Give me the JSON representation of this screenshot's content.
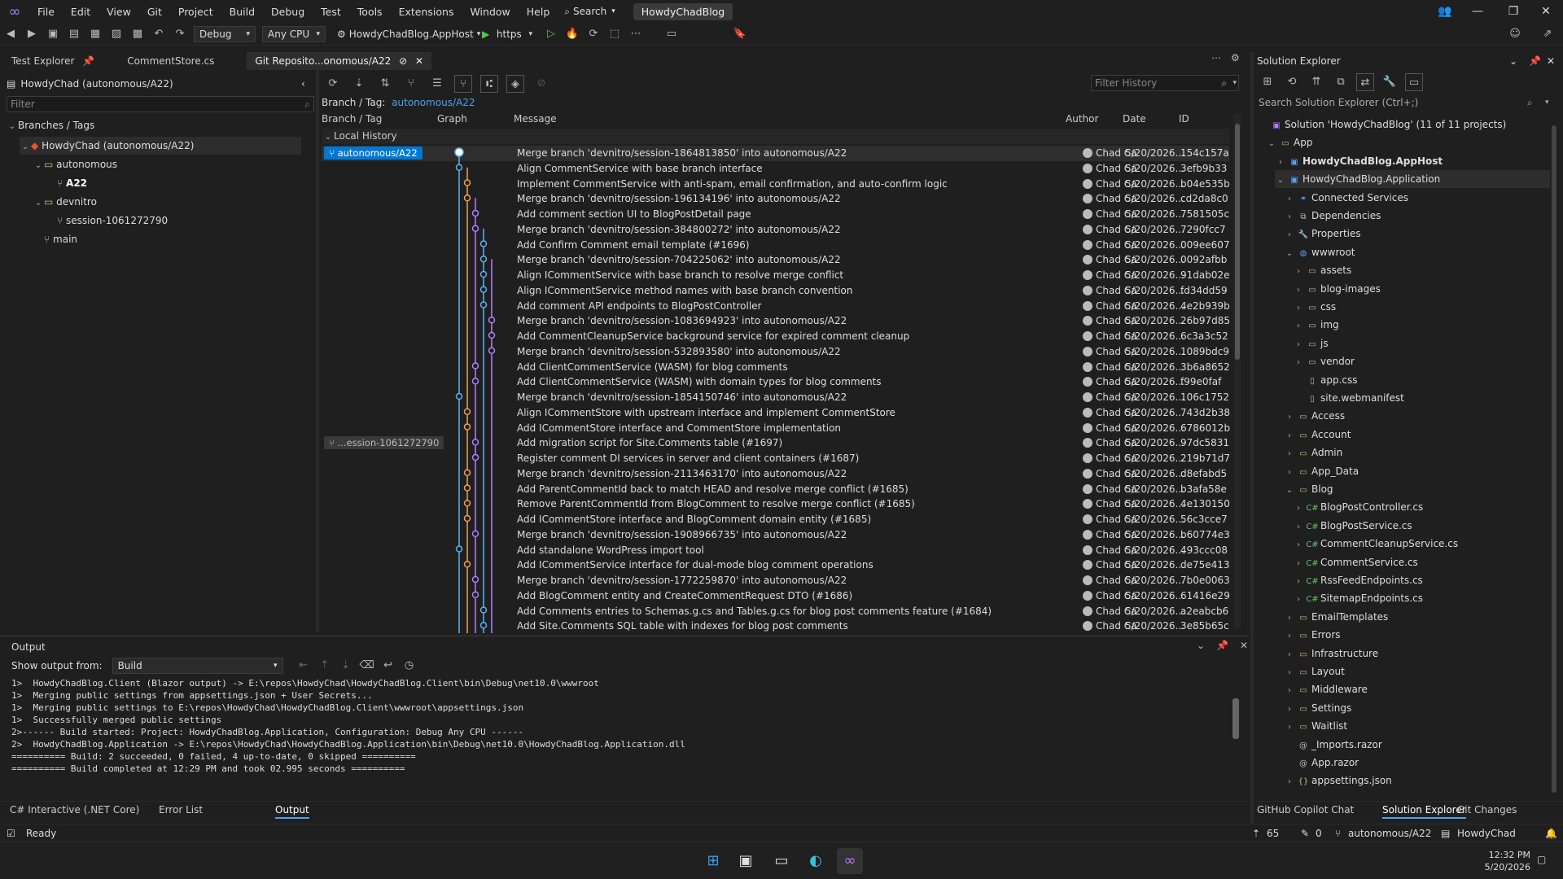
{
  "menubar": {
    "items": [
      "File",
      "Edit",
      "View",
      "Git",
      "Project",
      "Build",
      "Debug",
      "Test",
      "Tools",
      "Extensions",
      "Window",
      "Help"
    ],
    "search_label": "Search",
    "solution_title": "HowdyChadBlog"
  },
  "toolbar": {
    "config": "Debug",
    "platform": "Any CPU",
    "startup_project": "HowdyChadBlog.AppHost",
    "run_profile": "https"
  },
  "tabs": [
    {
      "label": "Test Explorer"
    },
    {
      "label": "CommentStore.cs"
    },
    {
      "label": "Git Reposito...onomous/A22"
    }
  ],
  "left_panel": {
    "header": "HowdyChad (autonomous/A22)",
    "filter_placeholder": "Filter",
    "section": "Branches / Tags",
    "tree": [
      {
        "label": "HowdyChad (autonomous/A22)",
        "kind": "repo"
      },
      {
        "label": "autonomous",
        "kind": "folder"
      },
      {
        "label": "A22",
        "kind": "branch"
      },
      {
        "label": "devnitro",
        "kind": "folder"
      },
      {
        "label": "session-1061272790",
        "kind": "branch"
      },
      {
        "label": "main",
        "kind": "branch"
      }
    ]
  },
  "history": {
    "filter_placeholder": "Filter History",
    "branch_label": "Branch / Tag:",
    "branch_value": "autonomous/A22",
    "columns": [
      "Branch / Tag",
      "Graph",
      "Message",
      "Author",
      "Date",
      "ID"
    ],
    "group": "Local History",
    "tag_current": "autonomous/A22",
    "tag_session": "...ession-1061272790",
    "commits": [
      {
        "message": "Merge branch 'devnitro/session-1864813850' into autonomous/A22",
        "author": "Chad Ca",
        "date": "5/20/2026...",
        "id": "154c157a"
      },
      {
        "message": "Align CommentService with base branch interface",
        "author": "Chad Ca",
        "date": "5/20/2026...",
        "id": "3efb9b33"
      },
      {
        "message": "Implement CommentService with anti-spam, email confirmation, and auto-confirm logic",
        "author": "Chad Ca",
        "date": "5/20/2026...",
        "id": "b04e535b"
      },
      {
        "message": "Merge branch 'devnitro/session-196134196' into autonomous/A22",
        "author": "Chad Ca",
        "date": "5/20/2026...",
        "id": "cd2da8c0"
      },
      {
        "message": "Add comment section UI to BlogPostDetail page",
        "author": "Chad Ca",
        "date": "5/20/2026...",
        "id": "7581505c"
      },
      {
        "message": "Merge branch 'devnitro/session-384800272' into autonomous/A22",
        "author": "Chad Ca",
        "date": "5/20/2026...",
        "id": "7290fcc7"
      },
      {
        "message": "Add Confirm Comment email template (#1696)",
        "author": "Chad Ca",
        "date": "5/20/2026...",
        "id": "009ee607"
      },
      {
        "message": "Merge branch 'devnitro/session-704225062' into autonomous/A22",
        "author": "Chad Ca",
        "date": "5/20/2026...",
        "id": "0092afbb"
      },
      {
        "message": "Align ICommentService with base branch to resolve merge conflict",
        "author": "Chad Ca",
        "date": "5/20/2026...",
        "id": "91dab02e"
      },
      {
        "message": "Align ICommentService method names with base branch convention",
        "author": "Chad Ca",
        "date": "5/20/2026...",
        "id": "fd34dd59"
      },
      {
        "message": "Add comment API endpoints to BlogPostController",
        "author": "Chad Ca",
        "date": "5/20/2026...",
        "id": "4e2b939b"
      },
      {
        "message": "Merge branch 'devnitro/session-1083694923' into autonomous/A22",
        "author": "Chad Ca",
        "date": "5/20/2026...",
        "id": "26b97d85"
      },
      {
        "message": "Add CommentCleanupService background service for expired comment cleanup",
        "author": "Chad Ca",
        "date": "5/20/2026...",
        "id": "6c3a3c52"
      },
      {
        "message": "Merge branch 'devnitro/session-532893580' into autonomous/A22",
        "author": "Chad Ca",
        "date": "5/20/2026...",
        "id": "1089bdc9"
      },
      {
        "message": "Add ClientCommentService (WASM) for blog comments",
        "author": "Chad Ca",
        "date": "5/20/2026...",
        "id": "3b6a8652"
      },
      {
        "message": "Add ClientCommentService (WASM) with domain types for blog comments",
        "author": "Chad Ca",
        "date": "5/20/2026...",
        "id": "f99e0faf"
      },
      {
        "message": "Merge branch 'devnitro/session-1854150746' into autonomous/A22",
        "author": "Chad Ca",
        "date": "5/20/2026...",
        "id": "106c1752"
      },
      {
        "message": "Align ICommentStore with upstream interface and implement CommentStore",
        "author": "Chad Ca",
        "date": "5/20/2026...",
        "id": "743d2b38"
      },
      {
        "message": "Add ICommentStore interface and CommentStore implementation",
        "author": "Chad Ca",
        "date": "5/20/2026...",
        "id": "6786012b"
      },
      {
        "message": "Add migration script for Site.Comments table (#1697)",
        "author": "Chad Ca",
        "date": "5/20/2026...",
        "id": "97dc5831"
      },
      {
        "message": "Register comment DI services in server and client containers (#1687)",
        "author": "Chad Ca",
        "date": "5/20/2026...",
        "id": "219b71d7"
      },
      {
        "message": "Merge branch 'devnitro/session-2113463170' into autonomous/A22",
        "author": "Chad Ca",
        "date": "5/20/2026...",
        "id": "d8efabd5"
      },
      {
        "message": "Add ParentCommentId back to match HEAD and resolve merge conflict (#1685)",
        "author": "Chad Ca",
        "date": "5/20/2026...",
        "id": "b3afa58e"
      },
      {
        "message": "Remove ParentCommentId from BlogComment to resolve merge conflict (#1685)",
        "author": "Chad Ca",
        "date": "5/20/2026...",
        "id": "4e130150"
      },
      {
        "message": "Add ICommentStore interface and BlogComment domain entity (#1685)",
        "author": "Chad Ca",
        "date": "5/20/2026...",
        "id": "56c3cce7"
      },
      {
        "message": "Merge branch 'devnitro/session-1908966735' into autonomous/A22",
        "author": "Chad Ca",
        "date": "5/20/2026...",
        "id": "b60774e3"
      },
      {
        "message": "Add standalone WordPress import tool",
        "author": "Chad Ca",
        "date": "5/20/2026...",
        "id": "493ccc08"
      },
      {
        "message": "Add ICommentService interface for dual-mode blog comment operations",
        "author": "Chad Ca",
        "date": "5/20/2026...",
        "id": "de75e413"
      },
      {
        "message": "Merge branch 'devnitro/session-1772259870' into autonomous/A22",
        "author": "Chad Ca",
        "date": "5/20/2026...",
        "id": "7b0e0063"
      },
      {
        "message": "Add BlogComment entity and CreateCommentRequest DTO (#1686)",
        "author": "Chad Ca",
        "date": "5/20/2026...",
        "id": "61416e29"
      },
      {
        "message": "Add Comments entries to Schemas.g.cs and Tables.g.cs for blog post comments feature (#1684)",
        "author": "Chad Ca",
        "date": "5/20/2026...",
        "id": "a2eabcb6"
      },
      {
        "message": "Add Site.Comments SQL table with indexes for blog post comments",
        "author": "Chad Ca",
        "date": "5/20/2026...",
        "id": "3e85b65c"
      }
    ]
  },
  "output": {
    "title": "Output",
    "show_from_label": "Show output from:",
    "source": "Build",
    "lines": [
      "1>  HowdyChadBlog.Client (Blazor output) -> E:\\repos\\HowdyChad\\HowdyChadBlog.Client\\bin\\Debug\\net10.0\\wwwroot",
      "1>  Merging public settings from appsettings.json + User Secrets...",
      "1>  Merging public settings to E:\\repos\\HowdyChad\\HowdyChadBlog.Client\\wwwroot\\appsettings.json",
      "1>  Successfully merged public settings",
      "2>------ Build started: Project: HowdyChadBlog.Application, Configuration: Debug Any CPU ------",
      "2>  HowdyChadBlog.Application -> E:\\repos\\HowdyChad\\HowdyChadBlog.Application\\bin\\Debug\\net10.0\\HowdyChadBlog.Application.dll",
      "========== Build: 2 succeeded, 0 failed, 4 up-to-date, 0 skipped ==========",
      "========== Build completed at 12:29 PM and took 02.995 seconds =========="
    ],
    "bottom_tabs": [
      "C# Interactive (.NET Core)",
      "Error List",
      "Output"
    ]
  },
  "solution_explorer": {
    "title": "Solution Explorer",
    "search_placeholder": "Search Solution Explorer (Ctrl+;)",
    "items": [
      {
        "label": "Solution 'HowdyChadBlog' (11 of 11 projects)",
        "indent": 0,
        "chev": "",
        "icon": "solution"
      },
      {
        "label": "App",
        "indent": 1,
        "chev": "v",
        "icon": "folder"
      },
      {
        "label": "HowdyChadBlog.AppHost",
        "indent": 2,
        "chev": ">",
        "icon": "project",
        "bold": true
      },
      {
        "label": "HowdyChadBlog.Application",
        "indent": 2,
        "chev": "v",
        "icon": "project",
        "selected": true
      },
      {
        "label": "Connected Services",
        "indent": 3,
        "chev": ">",
        "icon": "service"
      },
      {
        "label": "Dependencies",
        "indent": 3,
        "chev": ">",
        "icon": "deps"
      },
      {
        "label": "Properties",
        "indent": 3,
        "chev": ">",
        "icon": "props"
      },
      {
        "label": "wwwroot",
        "indent": 3,
        "chev": "v",
        "icon": "globe"
      },
      {
        "label": "assets",
        "indent": 4,
        "chev": ">",
        "icon": "folder"
      },
      {
        "label": "blog-images",
        "indent": 4,
        "chev": ">",
        "icon": "folder"
      },
      {
        "label": "css",
        "indent": 4,
        "chev": ">",
        "icon": "folder"
      },
      {
        "label": "img",
        "indent": 4,
        "chev": ">",
        "icon": "folder"
      },
      {
        "label": "js",
        "indent": 4,
        "chev": ">",
        "icon": "folder"
      },
      {
        "label": "vendor",
        "indent": 4,
        "chev": ">",
        "icon": "folder"
      },
      {
        "label": "app.css",
        "indent": 4,
        "chev": "",
        "icon": "file"
      },
      {
        "label": "site.webmanifest",
        "indent": 4,
        "chev": "",
        "icon": "file"
      },
      {
        "label": "Access",
        "indent": 3,
        "chev": ">",
        "icon": "folder"
      },
      {
        "label": "Account",
        "indent": 3,
        "chev": ">",
        "icon": "folder"
      },
      {
        "label": "Admin",
        "indent": 3,
        "chev": ">",
        "icon": "folder"
      },
      {
        "label": "App_Data",
        "indent": 3,
        "chev": ">",
        "icon": "folder"
      },
      {
        "label": "Blog",
        "indent": 3,
        "chev": "v",
        "icon": "folder"
      },
      {
        "label": "BlogPostController.cs",
        "indent": 4,
        "chev": ">",
        "icon": "cs"
      },
      {
        "label": "BlogPostService.cs",
        "indent": 4,
        "chev": ">",
        "icon": "cs"
      },
      {
        "label": "CommentCleanupService.cs",
        "indent": 4,
        "chev": ">",
        "icon": "cs"
      },
      {
        "label": "CommentService.cs",
        "indent": 4,
        "chev": ">",
        "icon": "cs"
      },
      {
        "label": "RssFeedEndpoints.cs",
        "indent": 4,
        "chev": ">",
        "icon": "cs"
      },
      {
        "label": "SitemapEndpoints.cs",
        "indent": 4,
        "chev": ">",
        "icon": "cs"
      },
      {
        "label": "EmailTemplates",
        "indent": 3,
        "chev": ">",
        "icon": "folder"
      },
      {
        "label": "Errors",
        "indent": 3,
        "chev": ">",
        "icon": "folder"
      },
      {
        "label": "Infrastructure",
        "indent": 3,
        "chev": ">",
        "icon": "folder"
      },
      {
        "label": "Layout",
        "indent": 3,
        "chev": ">",
        "icon": "folder"
      },
      {
        "label": "Middleware",
        "indent": 3,
        "chev": ">",
        "icon": "folder"
      },
      {
        "label": "Settings",
        "indent": 3,
        "chev": ">",
        "icon": "folder"
      },
      {
        "label": "Waitlist",
        "indent": 3,
        "chev": ">",
        "icon": "folder"
      },
      {
        "label": "_Imports.razor",
        "indent": 3,
        "chev": "",
        "icon": "razor"
      },
      {
        "label": "App.razor",
        "indent": 3,
        "chev": "",
        "icon": "razor"
      },
      {
        "label": "appsettings.json",
        "indent": 3,
        "chev": ">",
        "icon": "json"
      }
    ],
    "bottom_tabs": [
      "GitHub Copilot Chat",
      "Solution Explorer",
      "Git Changes"
    ]
  },
  "statusbar": {
    "ready": "Ready",
    "errors": "65",
    "changes": "0",
    "branch": "autonomous/A22",
    "repo": "HowdyChad"
  },
  "taskbar": {
    "time": "12:32 PM",
    "date": "5/20/2026"
  },
  "colors": {
    "accent": "#0e639c",
    "selected_tag": "#0078d4",
    "graph_blue": "#5bb3f0",
    "graph_orange": "#f0a050",
    "graph_purple": "#b080ff"
  }
}
